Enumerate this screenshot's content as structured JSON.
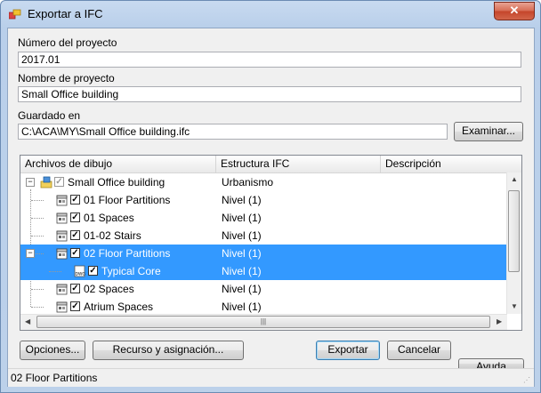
{
  "window": {
    "title": "Exportar a IFC",
    "close_label": "✕"
  },
  "form": {
    "project_number_label": "Número del proyecto",
    "project_number_value": "2017.01",
    "project_name_label": "Nombre de proyecto",
    "project_name_value": "Small Office building",
    "saved_in_label": "Guardado en",
    "saved_in_value": "C:\\ACA\\MY\\Small Office building.ifc",
    "browse_button": "Examinar..."
  },
  "tree": {
    "columns": [
      "Archivos de dibujo",
      "Estructura IFC",
      "Descripción"
    ],
    "rows": [
      {
        "name": "Small Office building",
        "structure": "Urbanismo",
        "level": 0,
        "icon": "project-icon",
        "checked": true,
        "grey": true,
        "expander": "−",
        "selected": false
      },
      {
        "name": "01 Floor Partitions",
        "structure": "Nivel (1)",
        "level": 1,
        "icon": "drawing-icon",
        "checked": true,
        "grey": false,
        "expander": "",
        "selected": false
      },
      {
        "name": "01 Spaces",
        "structure": "Nivel (1)",
        "level": 1,
        "icon": "drawing-icon",
        "checked": true,
        "grey": false,
        "expander": "",
        "selected": false
      },
      {
        "name": "01-02 Stairs",
        "structure": "Nivel (1)",
        "level": 1,
        "icon": "drawing-icon",
        "checked": true,
        "grey": false,
        "expander": "",
        "selected": false
      },
      {
        "name": "02 Floor Partitions",
        "structure": "Nivel (1)",
        "level": 1,
        "icon": "drawing-icon",
        "checked": true,
        "grey": false,
        "expander": "−",
        "selected": true
      },
      {
        "name": "Typical Core",
        "structure": "Nivel (1)",
        "level": 2,
        "icon": "dwg-icon",
        "checked": true,
        "grey": false,
        "expander": "",
        "selected": true
      },
      {
        "name": "02 Spaces",
        "structure": "Nivel (1)",
        "level": 1,
        "icon": "drawing-icon",
        "checked": true,
        "grey": false,
        "expander": "",
        "selected": false
      },
      {
        "name": "Atrium Spaces",
        "structure": "Nivel (1)",
        "level": 1,
        "icon": "drawing-icon",
        "checked": true,
        "grey": false,
        "expander": "",
        "selected": false
      }
    ]
  },
  "buttons": {
    "options": "Opciones...",
    "resource": "Recurso y asignación...",
    "export": "Exportar",
    "cancel": "Cancelar",
    "help": "Ayuda"
  },
  "status": {
    "text": "02 Floor Partitions"
  },
  "colors": {
    "selection": "#3399ff",
    "title_bar": "#c8daf0",
    "close_button": "#c4452a"
  }
}
